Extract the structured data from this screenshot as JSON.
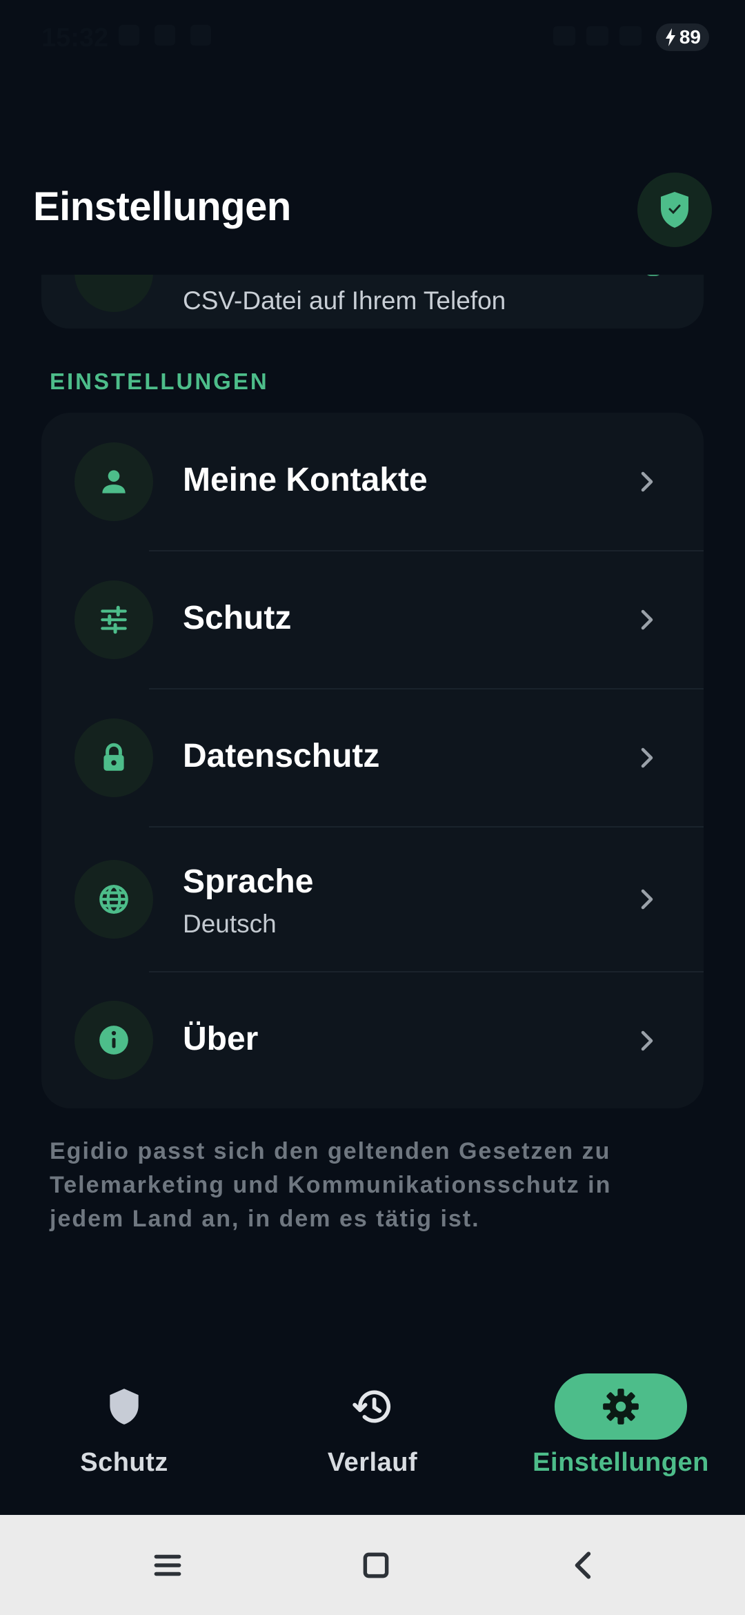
{
  "status_bar": {
    "time": "15:32",
    "battery": "89"
  },
  "header": {
    "title": "Einstellungen"
  },
  "previous_card": {
    "subtitle": "CSV-Datei auf Ihrem Telefon"
  },
  "settings": {
    "section_label": "EINSTELLUNGEN",
    "items": [
      {
        "title": "Meine Kontakte",
        "icon": "person-icon"
      },
      {
        "title": "Schutz",
        "icon": "sliders-icon"
      },
      {
        "title": "Datenschutz",
        "icon": "lock-icon"
      },
      {
        "title": "Sprache",
        "subtitle": "Deutsch",
        "icon": "globe-icon"
      },
      {
        "title": "Über",
        "icon": "info-icon"
      }
    ]
  },
  "footer_note": "Egidio passt sich den geltenden Gesetzen zu Telemarketing und Kommunikationsschutz in jedem Land an, in dem es tätig ist.",
  "bottom_nav": {
    "items": [
      {
        "label": "Schutz",
        "icon": "shield-icon",
        "active": false
      },
      {
        "label": "Verlauf",
        "icon": "history-icon",
        "active": false
      },
      {
        "label": "Einstellungen",
        "icon": "gear-icon",
        "active": true
      }
    ]
  },
  "colors": {
    "background": "#080e17",
    "card": "#0e151d",
    "accent": "#4dbd8a",
    "icon_circle": "#14221e"
  }
}
